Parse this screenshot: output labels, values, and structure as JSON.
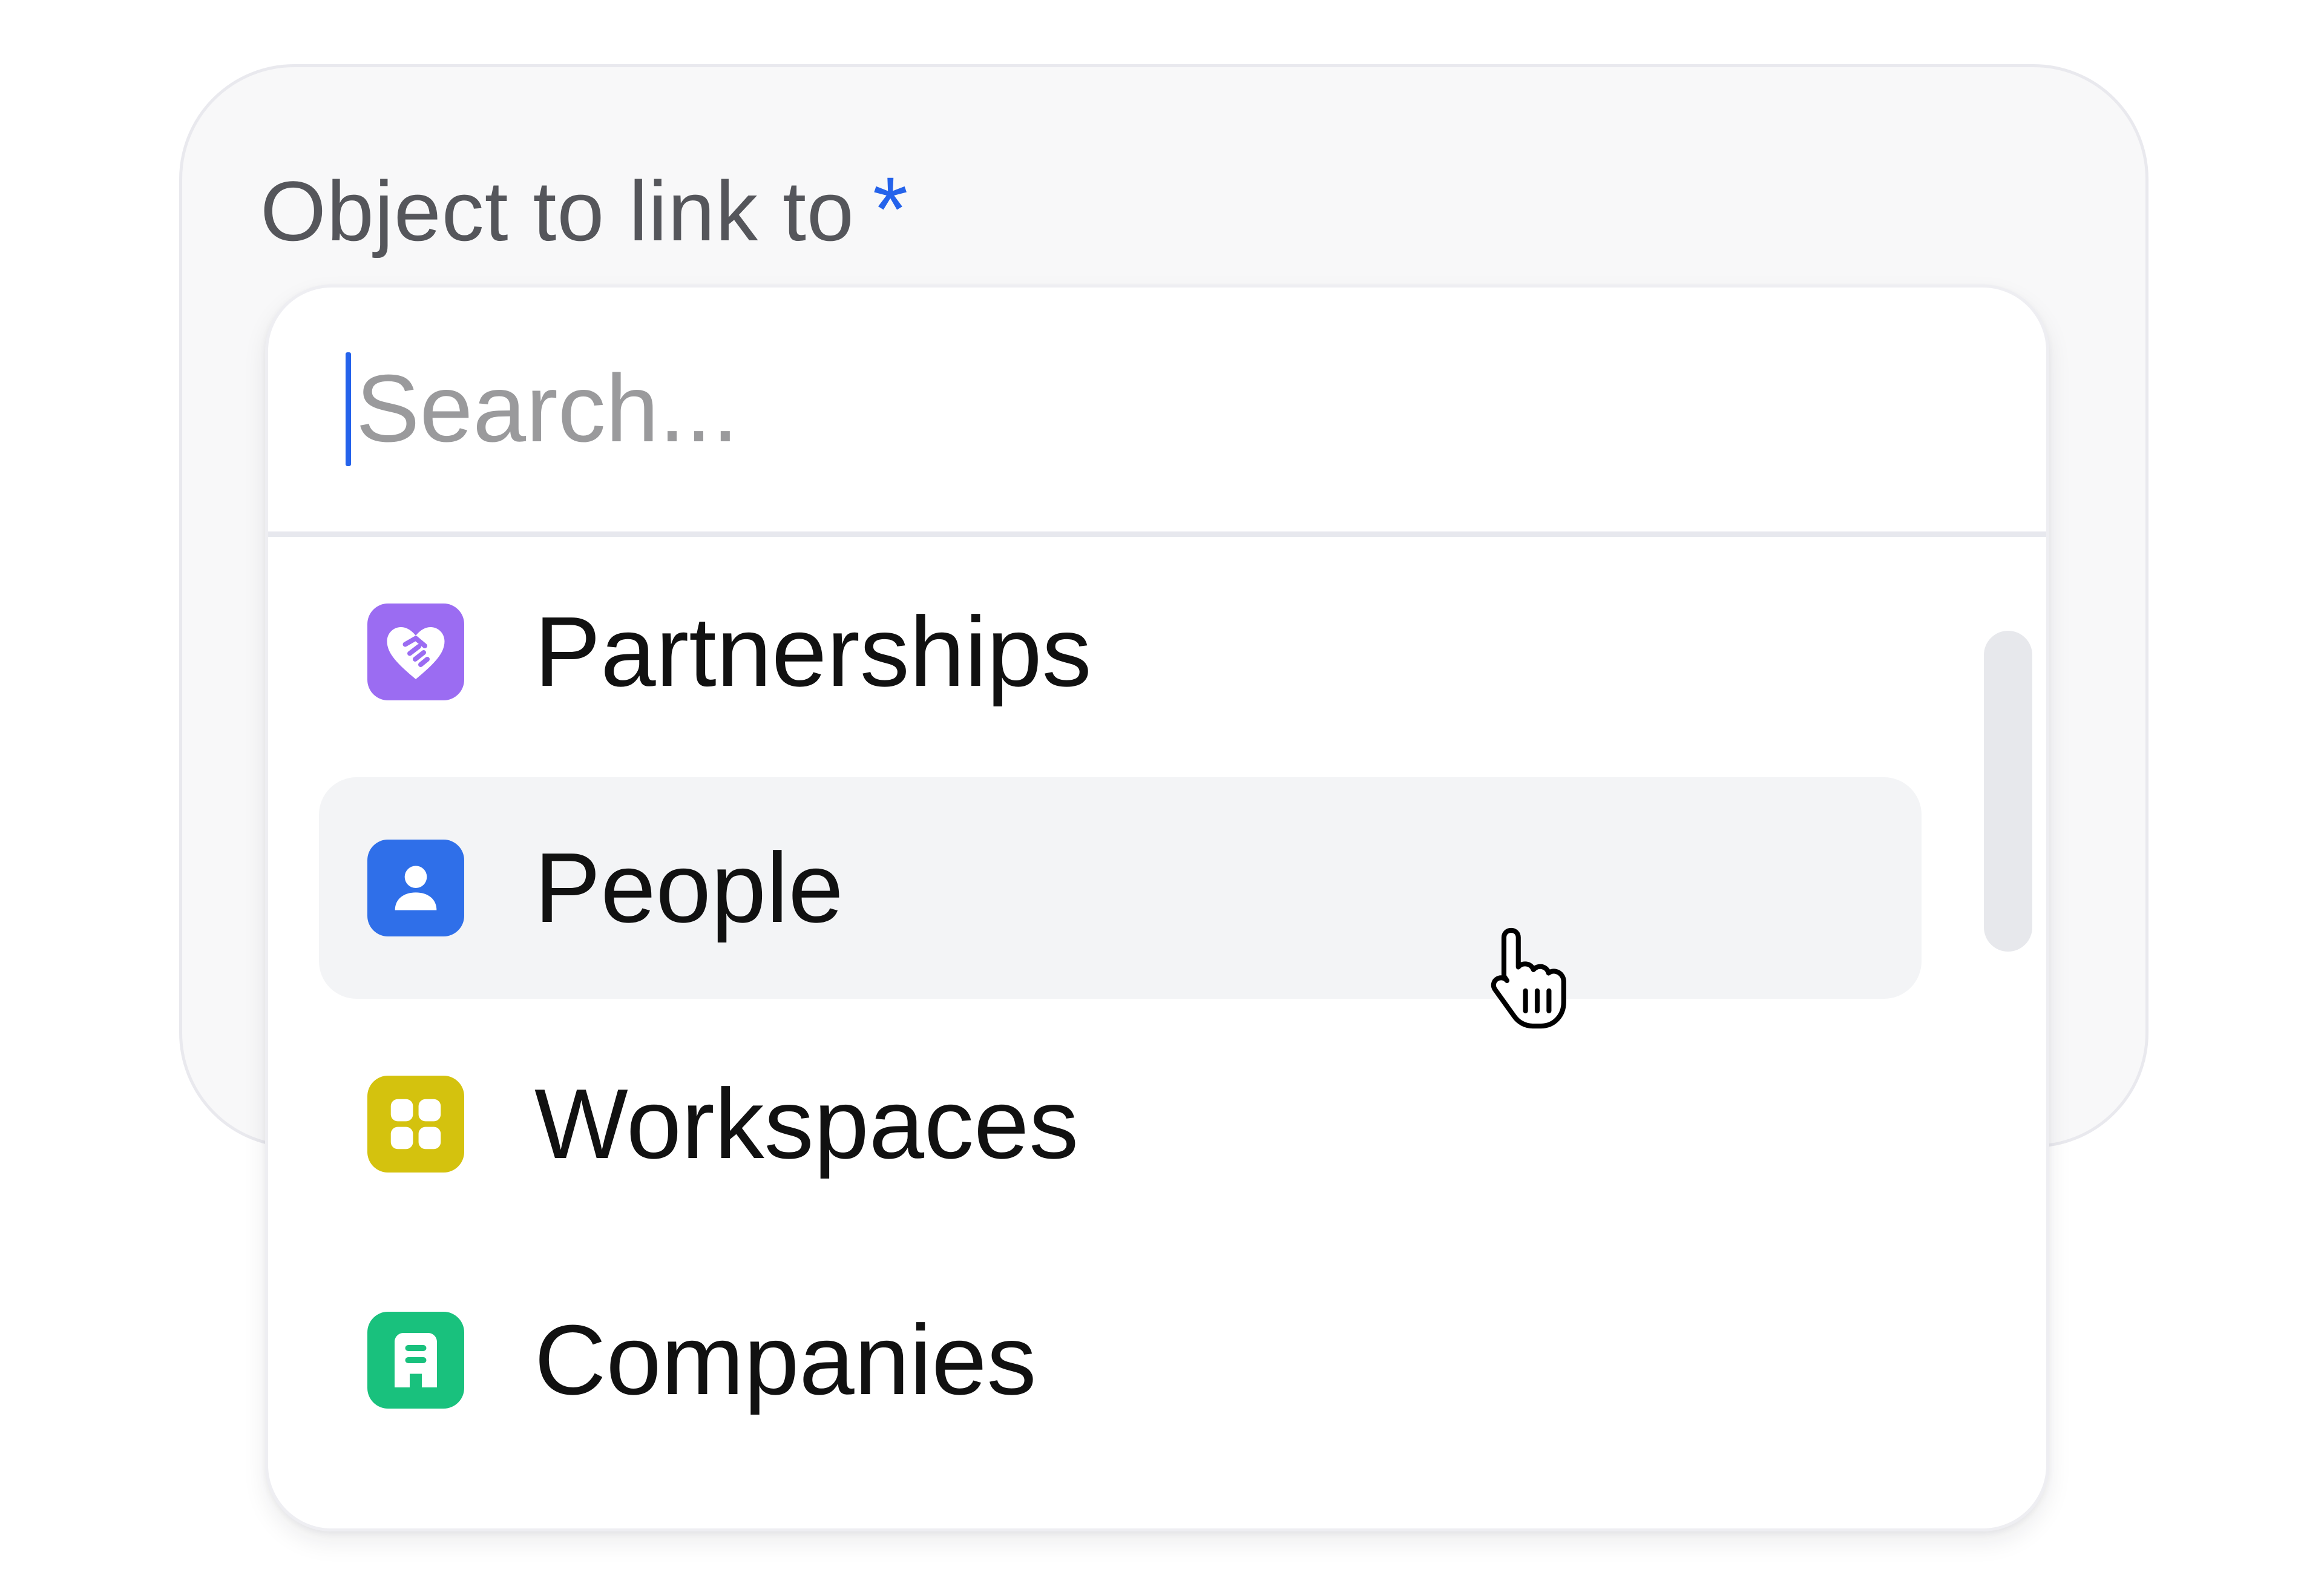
{
  "field": {
    "label": "Object to link to",
    "required_marker": "*"
  },
  "search": {
    "placeholder": "Search...",
    "value": ""
  },
  "options": [
    {
      "label": "Partnerships",
      "icon": "heart-handshake-icon",
      "color": "#9b6cf2"
    },
    {
      "label": "People",
      "icon": "person-icon",
      "color": "#2f6fe9",
      "hovered": true
    },
    {
      "label": "Workspaces",
      "icon": "grid-icon",
      "color": "#d4c20e"
    },
    {
      "label": "Companies",
      "icon": "building-icon",
      "color": "#19c17d"
    }
  ],
  "colors": {
    "accent": "#2563eb",
    "hover_bg": "#f3f4f6"
  }
}
